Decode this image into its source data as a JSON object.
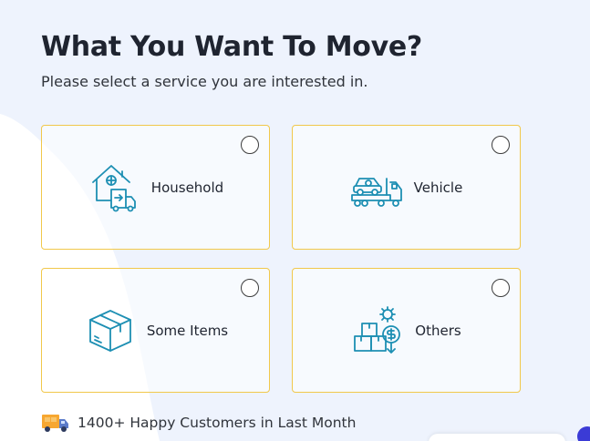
{
  "header": {
    "title": "What You Want To Move?",
    "subtitle": "Please select a service you are interested in."
  },
  "services": [
    {
      "label": "Household",
      "icon": "house-with-truck-icon",
      "selected": false
    },
    {
      "label": "Vehicle",
      "icon": "car-on-tow-truck-icon",
      "selected": false
    },
    {
      "label": "Some Items",
      "icon": "box-icon",
      "selected": false
    },
    {
      "label": "Others",
      "icon": "boxes-with-coin-gear-icon",
      "selected": false
    }
  ],
  "footer": {
    "note": "1400+ Happy Customers in Last Month",
    "icon": "delivery-truck-icon"
  },
  "colors": {
    "accent_border": "#f1c84b",
    "icon_stroke": "#1d8fb3",
    "background_tint": "#eef3fd",
    "text_dark": "#1f2430"
  }
}
